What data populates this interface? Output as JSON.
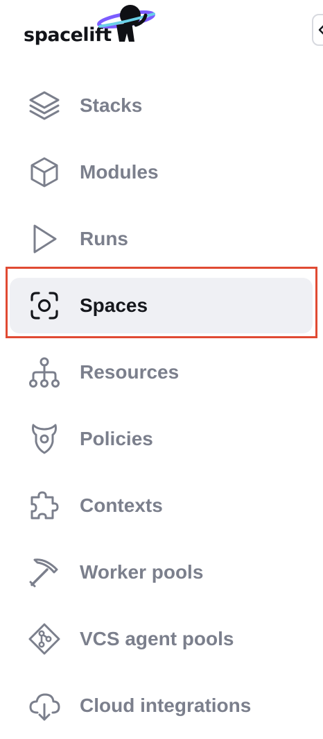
{
  "app": {
    "logo_text": "spacelift",
    "accent_color": "#7c5cff"
  },
  "collapse_button": {
    "icon": "chevron-left-icon"
  },
  "nav": {
    "items": [
      {
        "label": "Stacks",
        "icon": "layers-icon",
        "active": false
      },
      {
        "label": "Modules",
        "icon": "cube-icon",
        "active": false
      },
      {
        "label": "Runs",
        "icon": "play-icon",
        "active": false
      },
      {
        "label": "Spaces",
        "icon": "focus-frame-icon",
        "active": true
      },
      {
        "label": "Resources",
        "icon": "hierarchy-icon",
        "active": false
      },
      {
        "label": "Policies",
        "icon": "shield-horns-icon",
        "active": false
      },
      {
        "label": "Contexts",
        "icon": "puzzle-icon",
        "active": false
      },
      {
        "label": "Worker pools",
        "icon": "pickaxe-icon",
        "active": false
      },
      {
        "label": "VCS agent pools",
        "icon": "git-branch-diamond-icon",
        "active": false
      },
      {
        "label": "Cloud integrations",
        "icon": "cloud-download-icon",
        "active": false
      }
    ]
  },
  "colors": {
    "text_muted": "#7b7f8c",
    "text_active": "#15171c",
    "active_bg": "#eff0f4",
    "highlight_border": "#e04a33"
  }
}
